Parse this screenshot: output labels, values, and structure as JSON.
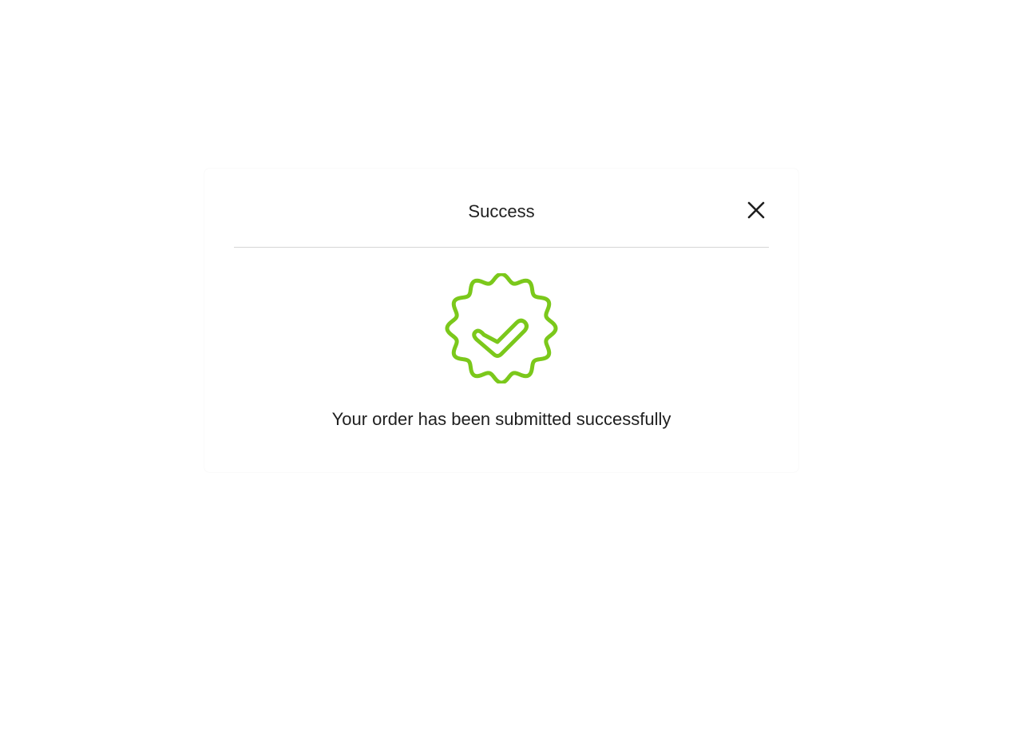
{
  "dialog": {
    "title": "Success",
    "message": "Your order has been submitted successfully",
    "close_icon": "close-icon",
    "badge_icon": "verified-badge-check-icon"
  },
  "colors": {
    "accent": "#7bc81b",
    "text": "#1f1f1f",
    "divider": "#d6d6d6"
  }
}
